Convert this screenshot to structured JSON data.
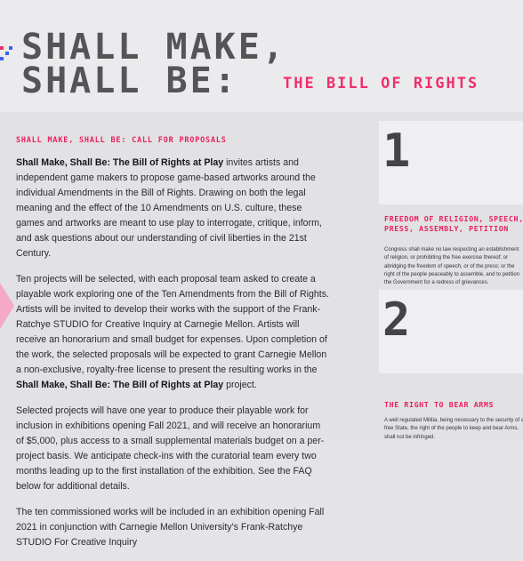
{
  "hero": {
    "line1": "SHALL MAKE,",
    "line2": "SHALL BE:",
    "subtitle": "THE BILL OF RIGHTS"
  },
  "call": {
    "title": "SHALL MAKE, SHALL BE: CALL FOR PROPOSALS",
    "p1_bold": "Shall Make, Shall Be: The Bill of Rights at Play",
    "p1_rest": " invites artists and independent game makers to propose game-based artworks around the individual Amendments in the Bill of Rights. Drawing on both the legal meaning and the effect of the 10 Amendments on U.S. culture, these games and artworks are meant to use play to interrogate, critique, inform, and ask questions about our understanding of civil liberties in the 21st Century.",
    "p2_text": "Ten projects will be selected, with each proposal team asked to create a playable work exploring one of the Ten Amendments from the Bill of Rights. Artists will be invited to develop their works with the support of the Frank-Ratchye STUDIO for Creative Inquiry at Carnegie Mellon. Artists will receive an honorarium and small budget for expenses. Upon completion of the work, the selected proposals will be expected to grant Carnegie Mellon a non-exclusive, royalty-free license to present the resulting works in the ",
    "p2_bold": "Shall Make, Shall Be: The Bill of Rights at Play",
    "p2_end": " project.",
    "p3": "Selected projects will have one year to produce their playable work for inclusion in exhibitions opening Fall 2021, and will receive an honorarium of $5,000, plus access to a small supplemental materials budget on a per-project basis. We anticipate check-ins with the curatorial team every two months leading up to the first installation of the exhibition. See the FAQ below for additional details.",
    "p4": "The ten commissioned works will be included in an exhibition opening Fall 2021 in conjunction with Carnegie Mellon University's Frank-Ratchye STUDIO For Creative Inquiry"
  },
  "amendments": [
    {
      "number": "1",
      "title": "FREEDOM OF RELIGION, SPEECH, PRESS, ASSEMBLY, PETITION",
      "text": "Congress shall make no law respecting an establishment of religion, or prohibiting the free exercise thereof; or abridging the freedom of speech, or of the press; or the right of the people peaceably to assemble, and to petition the Government for a redress of grievances."
    },
    {
      "number": "2",
      "title": "THE RIGHT TO BEAR ARMS",
      "text": "A well regulated Militia, being necessary to the security of a free State, the right of the people to keep and bear Arms, shall not be infringed."
    }
  ],
  "colors": {
    "accent_pink": "#e8205f",
    "hero_gray": "#555558",
    "deco_blue": "#3a63e6"
  }
}
